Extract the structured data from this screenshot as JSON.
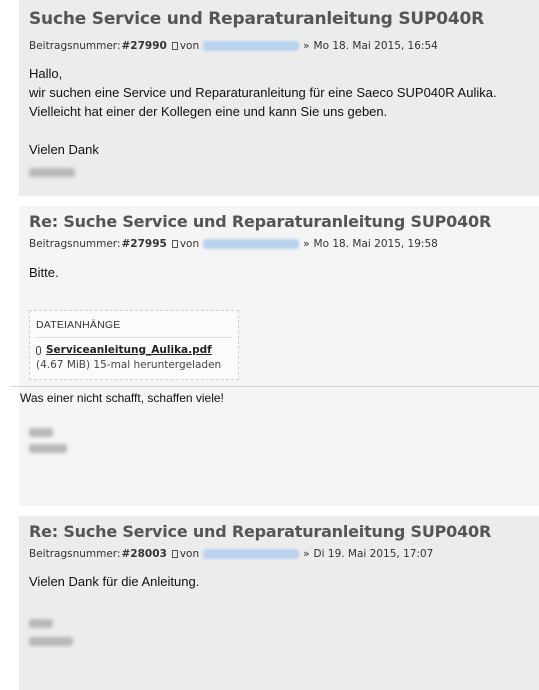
{
  "posts": [
    {
      "title": "Suche Service und Reparaturanleitung SUP040R",
      "meta_label": "Beitragsnummer:",
      "number": "#27990",
      "by": "von",
      "separator": "»",
      "date": "Mo 18. Mai 2015, 16:54",
      "lines": [
        "Hallo,",
        "wir suchen eine Service und Reparaturanleitung für eine Saeco SUP040R Aulika.",
        "Vielleicht hat einer der Kollegen eine und kann Sie uns geben.",
        "",
        "Vielen Dank"
      ]
    },
    {
      "title": "Re: Suche Service und Reparaturanleitung SUP040R",
      "meta_label": "Beitragsnummer:",
      "number": "#27995",
      "by": "von",
      "separator": "»",
      "date": "Mo 18. Mai 2015, 19:58",
      "lines": [
        "Bitte."
      ],
      "attachment": {
        "heading": "DATEIANHÄNGE",
        "file_name": "Serviceanleitung_Aulika.pdf",
        "info": "(4.67 MiB) 15-mal heruntergeladen"
      },
      "signature_line": "Was einer nicht schafft, schaffen viele!"
    },
    {
      "title": "Re: Suche Service und Reparaturanleitung SUP040R",
      "meta_label": "Beitragsnummer:",
      "number": "#28003",
      "by": "von",
      "separator": "»",
      "date": "Di 19. Mai 2015, 17:07",
      "lines": [
        "Vielen Dank für die Anleitung."
      ]
    }
  ],
  "icons": {
    "post_link": "document-icon",
    "attachment": "paperclip-icon"
  },
  "colors": {
    "post_bg": "#ececec",
    "title": "#555555",
    "blurred_name": "#b9d3ef",
    "blurred_signature": "#b8b8b8"
  }
}
